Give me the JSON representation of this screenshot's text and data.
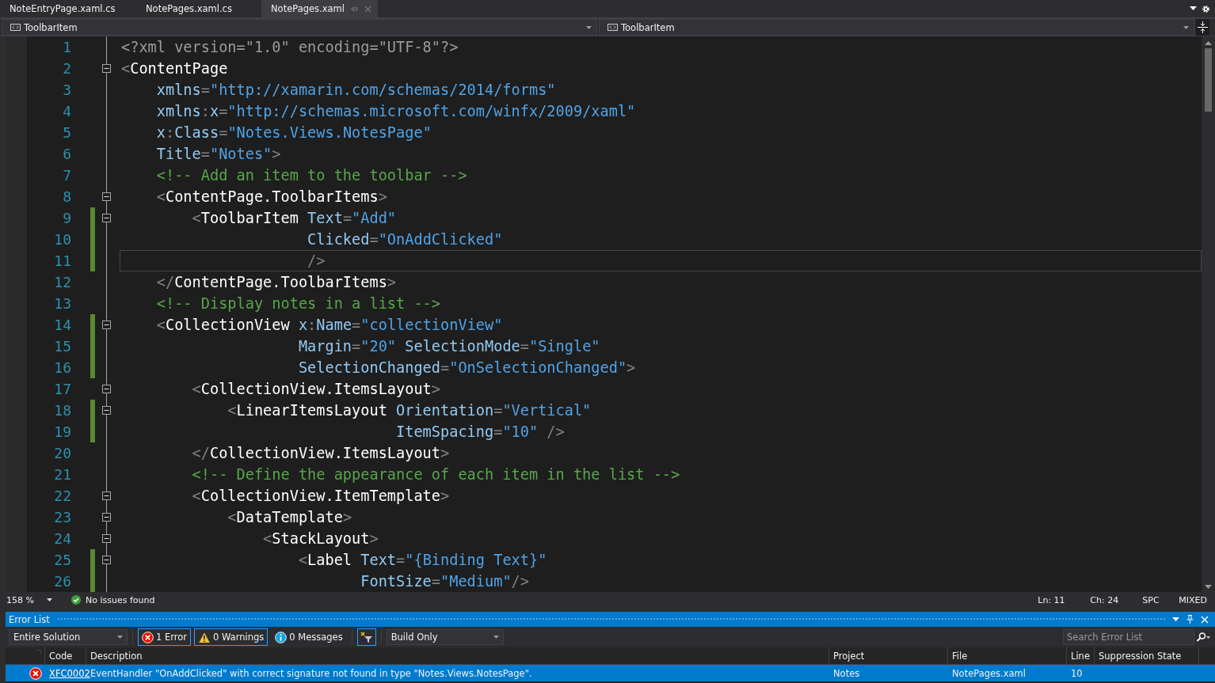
{
  "tabs": [
    {
      "label": "NoteEntryPage.xaml.cs",
      "selected": false
    },
    {
      "label": "NotePages.xaml.cs",
      "selected": false
    },
    {
      "label": "NotePages.xaml",
      "selected": true
    }
  ],
  "navigation_bar": {
    "left": "ToolbarItem",
    "right": "ToolbarItem"
  },
  "editor": {
    "lines": [
      {
        "number": "1",
        "changed": false,
        "foldable": false,
        "current": false,
        "tokens": [
          {
            "kind": "pi",
            "text": "<?xml version=\"1.0\" encoding=\"UTF-8\"?>"
          }
        ]
      },
      {
        "number": "2",
        "changed": false,
        "foldable": true,
        "current": false,
        "tokens": [
          {
            "kind": "d",
            "text": "<"
          },
          {
            "kind": "el",
            "text": "ContentPage"
          }
        ]
      },
      {
        "number": "3",
        "changed": false,
        "foldable": false,
        "current": false,
        "tokens": [
          {
            "kind": "at",
            "text": "    xmlns"
          },
          {
            "kind": "d",
            "text": "="
          },
          {
            "kind": "v",
            "text": "\"http://xamarin.com/schemas/2014/forms\""
          }
        ]
      },
      {
        "number": "4",
        "changed": false,
        "foldable": false,
        "current": false,
        "tokens": [
          {
            "kind": "at",
            "text": "    xmlns"
          },
          {
            "kind": "d",
            "text": ":"
          },
          {
            "kind": "at",
            "text": "x"
          },
          {
            "kind": "d",
            "text": "="
          },
          {
            "kind": "v",
            "text": "\"http://schemas.microsoft.com/winfx/2009/xaml\""
          }
        ]
      },
      {
        "number": "5",
        "changed": false,
        "foldable": false,
        "current": false,
        "tokens": [
          {
            "kind": "at",
            "text": "    x"
          },
          {
            "kind": "d",
            "text": ":"
          },
          {
            "kind": "at",
            "text": "Class"
          },
          {
            "kind": "d",
            "text": "="
          },
          {
            "kind": "v",
            "text": "\"Notes.Views.NotesPage\""
          }
        ]
      },
      {
        "number": "6",
        "changed": false,
        "foldable": false,
        "current": false,
        "tokens": [
          {
            "kind": "at",
            "text": "    Title"
          },
          {
            "kind": "d",
            "text": "="
          },
          {
            "kind": "v",
            "text": "\"Notes\""
          },
          {
            "kind": "d",
            "text": ">"
          }
        ]
      },
      {
        "number": "7",
        "changed": false,
        "foldable": false,
        "current": false,
        "tokens": [
          {
            "kind": "c",
            "text": "    <!-- Add an item to the toolbar -->"
          }
        ]
      },
      {
        "number": "8",
        "changed": false,
        "foldable": true,
        "current": false,
        "tokens": [
          {
            "kind": "d",
            "text": "    <"
          },
          {
            "kind": "el",
            "text": "ContentPage.ToolbarItems"
          },
          {
            "kind": "d",
            "text": ">"
          }
        ]
      },
      {
        "number": "9",
        "changed": true,
        "foldable": true,
        "current": false,
        "tokens": [
          {
            "kind": "d",
            "text": "        <"
          },
          {
            "kind": "el",
            "text": "ToolbarItem "
          },
          {
            "kind": "at",
            "text": "Text"
          },
          {
            "kind": "d",
            "text": "="
          },
          {
            "kind": "v",
            "text": "\"Add\""
          }
        ]
      },
      {
        "number": "10",
        "changed": true,
        "foldable": false,
        "current": false,
        "tokens": [
          {
            "kind": "at",
            "text": "                     Clicked"
          },
          {
            "kind": "d",
            "text": "="
          },
          {
            "kind": "v",
            "text": "\"OnAddClicked\""
          }
        ]
      },
      {
        "number": "11",
        "changed": true,
        "foldable": false,
        "current": true,
        "tokens": [
          {
            "kind": "d",
            "text": "                     />"
          }
        ]
      },
      {
        "number": "12",
        "changed": false,
        "foldable": false,
        "current": false,
        "tokens": [
          {
            "kind": "d",
            "text": "    </"
          },
          {
            "kind": "el",
            "text": "ContentPage.ToolbarItems"
          },
          {
            "kind": "d",
            "text": ">"
          }
        ]
      },
      {
        "number": "13",
        "changed": false,
        "foldable": false,
        "current": false,
        "tokens": [
          {
            "kind": "c",
            "text": "    <!-- Display notes in a list -->"
          }
        ]
      },
      {
        "number": "14",
        "changed": true,
        "foldable": true,
        "current": false,
        "tokens": [
          {
            "kind": "d",
            "text": "    <"
          },
          {
            "kind": "el",
            "text": "CollectionView "
          },
          {
            "kind": "at",
            "text": "x"
          },
          {
            "kind": "d",
            "text": ":"
          },
          {
            "kind": "at",
            "text": "Name"
          },
          {
            "kind": "d",
            "text": "="
          },
          {
            "kind": "v",
            "text": "\"collectionView\""
          }
        ]
      },
      {
        "number": "15",
        "changed": true,
        "foldable": false,
        "current": false,
        "tokens": [
          {
            "kind": "at",
            "text": "                    Margin"
          },
          {
            "kind": "d",
            "text": "="
          },
          {
            "kind": "v",
            "text": "\"20\" "
          },
          {
            "kind": "at",
            "text": "SelectionMode"
          },
          {
            "kind": "d",
            "text": "="
          },
          {
            "kind": "v",
            "text": "\"Single\""
          }
        ]
      },
      {
        "number": "16",
        "changed": true,
        "foldable": false,
        "current": false,
        "tokens": [
          {
            "kind": "at",
            "text": "                    SelectionChanged"
          },
          {
            "kind": "d",
            "text": "="
          },
          {
            "kind": "v",
            "text": "\"OnSelectionChanged\""
          },
          {
            "kind": "d",
            "text": ">"
          }
        ]
      },
      {
        "number": "17",
        "changed": false,
        "foldable": true,
        "current": false,
        "tokens": [
          {
            "kind": "d",
            "text": "        <"
          },
          {
            "kind": "el",
            "text": "CollectionView.ItemsLayout"
          },
          {
            "kind": "d",
            "text": ">"
          }
        ]
      },
      {
        "number": "18",
        "changed": true,
        "foldable": true,
        "current": false,
        "tokens": [
          {
            "kind": "d",
            "text": "            <"
          },
          {
            "kind": "el",
            "text": "LinearItemsLayout "
          },
          {
            "kind": "at",
            "text": "Orientation"
          },
          {
            "kind": "d",
            "text": "="
          },
          {
            "kind": "v",
            "text": "\"Vertical\""
          }
        ]
      },
      {
        "number": "19",
        "changed": true,
        "foldable": false,
        "current": false,
        "tokens": [
          {
            "kind": "at",
            "text": "                               ItemSpacing"
          },
          {
            "kind": "d",
            "text": "="
          },
          {
            "kind": "v",
            "text": "\"10\" "
          },
          {
            "kind": "d",
            "text": "/>"
          }
        ]
      },
      {
        "number": "20",
        "changed": false,
        "foldable": false,
        "current": false,
        "tokens": [
          {
            "kind": "d",
            "text": "        </"
          },
          {
            "kind": "el",
            "text": "CollectionView.ItemsLayout"
          },
          {
            "kind": "d",
            "text": ">"
          }
        ]
      },
      {
        "number": "21",
        "changed": false,
        "foldable": false,
        "current": false,
        "tokens": [
          {
            "kind": "c",
            "text": "        <!-- Define the appearance of each item in the list -->"
          }
        ]
      },
      {
        "number": "22",
        "changed": false,
        "foldable": true,
        "current": false,
        "tokens": [
          {
            "kind": "d",
            "text": "        <"
          },
          {
            "kind": "el",
            "text": "CollectionView.ItemTemplate"
          },
          {
            "kind": "d",
            "text": ">"
          }
        ]
      },
      {
        "number": "23",
        "changed": false,
        "foldable": true,
        "current": false,
        "tokens": [
          {
            "kind": "d",
            "text": "            <"
          },
          {
            "kind": "el",
            "text": "DataTemplate"
          },
          {
            "kind": "d",
            "text": ">"
          }
        ]
      },
      {
        "number": "24",
        "changed": false,
        "foldable": true,
        "current": false,
        "tokens": [
          {
            "kind": "d",
            "text": "                <"
          },
          {
            "kind": "el",
            "text": "StackLayout"
          },
          {
            "kind": "d",
            "text": ">"
          }
        ]
      },
      {
        "number": "25",
        "changed": true,
        "foldable": true,
        "current": false,
        "tokens": [
          {
            "kind": "d",
            "text": "                    <"
          },
          {
            "kind": "el",
            "text": "Label "
          },
          {
            "kind": "at",
            "text": "Text"
          },
          {
            "kind": "d",
            "text": "="
          },
          {
            "kind": "v",
            "text": "\"{Binding Text}\""
          }
        ]
      },
      {
        "number": "26",
        "changed": true,
        "foldable": false,
        "current": false,
        "tokens": [
          {
            "kind": "at",
            "text": "                           FontSize"
          },
          {
            "kind": "d",
            "text": "="
          },
          {
            "kind": "v",
            "text": "\"Medium\""
          },
          {
            "kind": "d",
            "text": "/>"
          }
        ]
      }
    ]
  },
  "editor_status": {
    "zoom": "158 %",
    "issues": "No issues found",
    "line": "Ln: 11",
    "column": "Ch: 24",
    "whitespace": "SPC",
    "line_endings": "MIXED"
  },
  "error_list": {
    "title": "Error List",
    "scope": "Entire Solution",
    "filters": [
      {
        "kind": "error",
        "label": "1 Error",
        "selected": true
      },
      {
        "kind": "warning",
        "label": "0 Warnings",
        "selected": true
      },
      {
        "kind": "message",
        "label": "0 Messages",
        "selected": false
      }
    ],
    "build_filter": "Build Only",
    "search": {
      "placeholder": "Search Error List"
    },
    "columns": [
      "Code",
      "Description",
      "Project",
      "File",
      "Line",
      "Suppression State"
    ],
    "rows": [
      {
        "code": "XFC0002",
        "description": "EventHandler \"OnAddClicked\" with correct signature not found in type \"Notes.Views.NotesPage\".",
        "project": "Notes",
        "file": "NotePages.xaml",
        "line": "10",
        "selected": true
      }
    ]
  }
}
